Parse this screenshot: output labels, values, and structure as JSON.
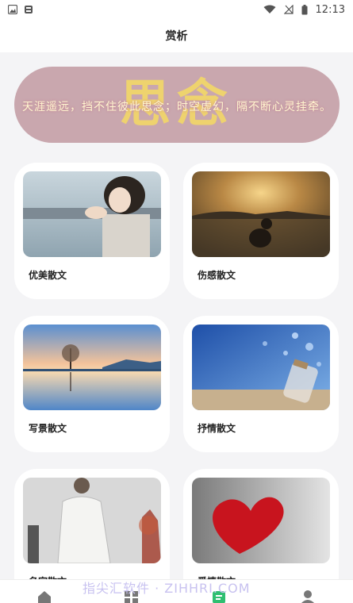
{
  "status_bar": {
    "time": "12:13"
  },
  "header": {
    "title": "赏析"
  },
  "banner": {
    "big_text": "思念",
    "caption": "天涯遥远，挡不住彼此思念；时空虚幻，隔不断心灵挂牵。"
  },
  "cards": [
    {
      "label": "优美散文",
      "image": "girl-by-railing-photo"
    },
    {
      "label": "伤感散文",
      "image": "sad-figure-sunset-photo"
    },
    {
      "label": "写景散文",
      "image": "lake-reflection-photo"
    },
    {
      "label": "抒情散文",
      "image": "glass-jar-hearts-photo"
    },
    {
      "label": "名家散文",
      "image": "scholar-in-robe-photo"
    },
    {
      "label": "爱情散文",
      "image": "red-yarn-heart-photo"
    }
  ],
  "watermark": "指尖汇软件 · ZIHHRI.COM",
  "colors": {
    "background": "#f4f4f6",
    "banner": "#c9a7ae",
    "accent": "#2fbf71"
  }
}
